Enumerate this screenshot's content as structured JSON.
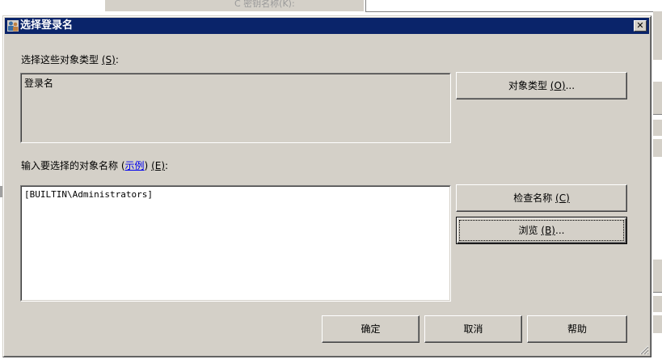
{
  "background": {
    "radio_label": "C 密钥名称(K):"
  },
  "dialog": {
    "title": "选择登录名",
    "close_glyph": "✕",
    "object_types_label": "选择这些对象类型",
    "object_types_accel": "(S)",
    "object_types_suffix": ":",
    "object_types_value": "登录名",
    "object_types_button": "对象类型",
    "object_types_button_accel": "(O)",
    "object_types_button_suffix": "...",
    "names_label": "输入要选择的对象名称",
    "names_link_open": "(",
    "names_link": "示例",
    "names_link_close": ")",
    "names_accel": "(E)",
    "names_suffix": ":",
    "names_value": "[BUILTIN\\Administrators]",
    "check_names_button": "检查名称",
    "check_names_accel": "(C)",
    "browse_button": "浏览",
    "browse_accel": "(B)",
    "browse_suffix": "...",
    "ok_button": "确定",
    "cancel_button": "取消",
    "help_button": "帮助"
  },
  "colors": {
    "titlebar": "#0a246a",
    "face": "#d4d0c8",
    "link": "#0000ee"
  }
}
